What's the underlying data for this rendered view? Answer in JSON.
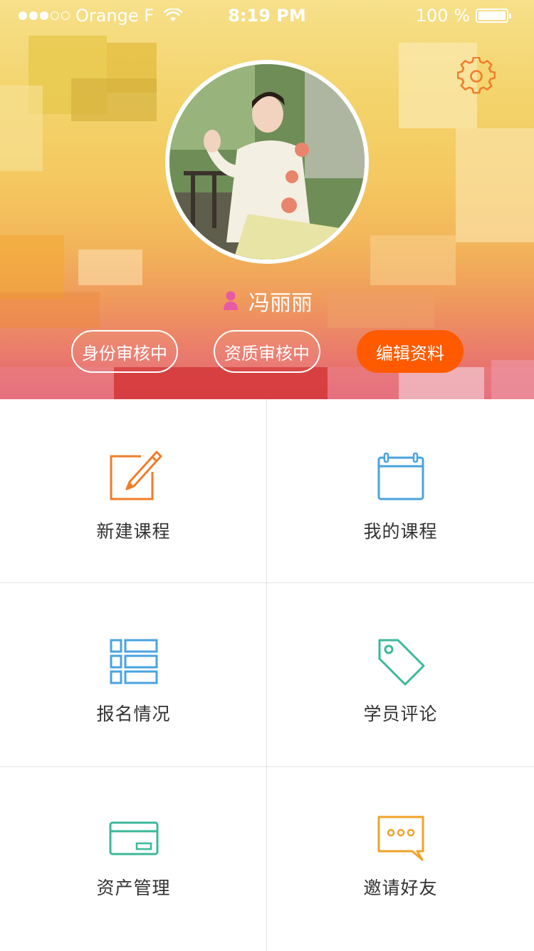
{
  "status_bar": {
    "carrier": "Orange F",
    "time": "8:19 PM",
    "battery": "100 %"
  },
  "profile": {
    "name": "冯丽丽",
    "settings_icon": "gear-icon",
    "badges": [
      {
        "label": "身份审核中",
        "style": "outline"
      },
      {
        "label": "资质审核中",
        "style": "outline"
      },
      {
        "label": "编辑资料",
        "style": "solid"
      }
    ]
  },
  "menu": [
    {
      "label": "新建课程",
      "icon": "edit-icon",
      "color": "#f07d2a"
    },
    {
      "label": "我的课程",
      "icon": "calendar-icon",
      "color": "#4aa3df"
    },
    {
      "label": "报名情况",
      "icon": "list-icon",
      "color": "#4aa3df"
    },
    {
      "label": "学员评论",
      "icon": "tag-icon",
      "color": "#3cb89a"
    },
    {
      "label": "资产管理",
      "icon": "card-icon",
      "color": "#3cb89a"
    },
    {
      "label": "邀请好友",
      "icon": "chat-icon",
      "color": "#f0a32a"
    }
  ],
  "colors": {
    "accent": "#ff5a00",
    "name_icon": "#e85aa6",
    "divider": "#e1e1e1"
  }
}
